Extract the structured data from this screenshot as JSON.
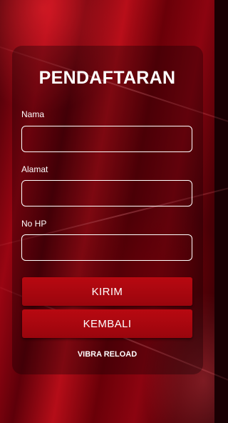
{
  "form": {
    "title": "PENDAFTARAN",
    "fields": [
      {
        "label": "Nama",
        "value": "",
        "placeholder": ""
      },
      {
        "label": "Alamat",
        "value": "",
        "placeholder": ""
      },
      {
        "label": "No HP",
        "value": "",
        "placeholder": ""
      }
    ],
    "submit_label": "KIRIM",
    "back_label": "KEMBALI",
    "footer_text": "VIBRA RELOAD"
  },
  "colors": {
    "background": "#8c0410",
    "button": "#b80911",
    "text": "#ffffff"
  }
}
